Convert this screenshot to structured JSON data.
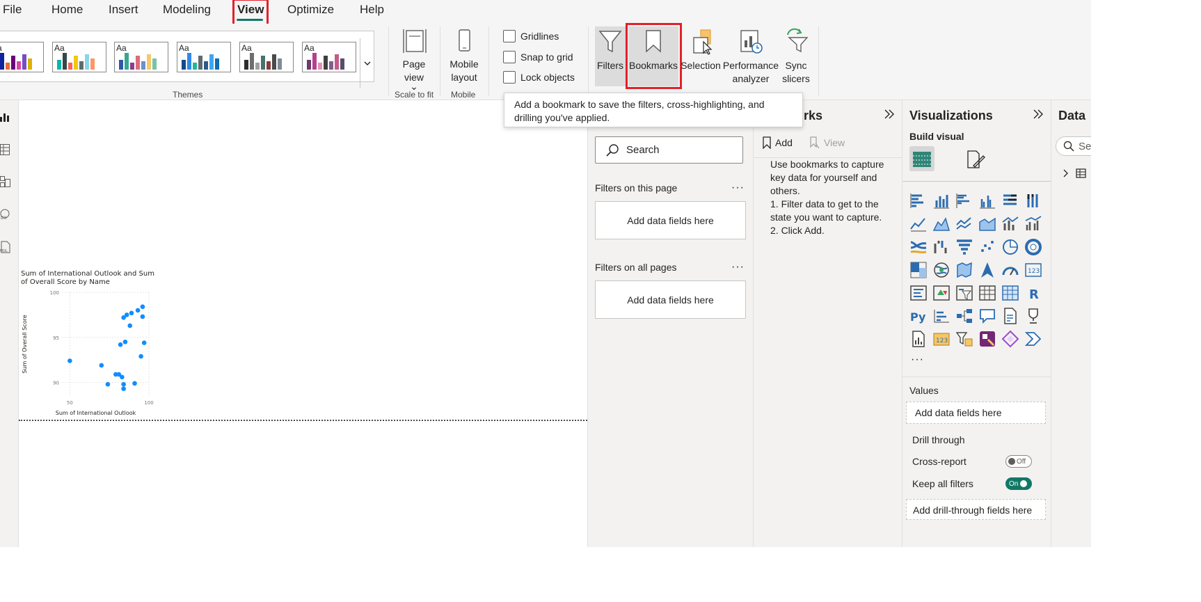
{
  "menu": {
    "items": [
      "File",
      "Home",
      "Insert",
      "Modeling",
      "View",
      "Optimize",
      "Help"
    ],
    "active": "View"
  },
  "ribbon": {
    "themes_label": "Themes",
    "theme_glyph": "Aa",
    "themes": [
      {
        "colors": [
          "#118dff",
          "#12239e",
          "#e66c37",
          "#6b007b",
          "#e044a7",
          "#744ec2",
          "#d9b300"
        ]
      },
      {
        "colors": [
          "#01b8aa",
          "#374649",
          "#fd625e",
          "#f2c80f",
          "#5f6b6d",
          "#8ad4eb",
          "#fe9666"
        ]
      },
      {
        "colors": [
          "#3257a8",
          "#37a794",
          "#8b3d88",
          "#dd6b7f",
          "#6b91c9",
          "#f5c869",
          "#77c4a8"
        ]
      },
      {
        "colors": [
          "#134a89",
          "#2e8ae6",
          "#1fb99f",
          "#5f6b6d",
          "#2a5b8c",
          "#41a5ee",
          "#0f6bb3"
        ]
      },
      {
        "colors": [
          "#2d2d2d",
          "#6e6e6e",
          "#a0a0a0",
          "#49716f",
          "#8d3b3b",
          "#4a4a4a",
          "#7d8b9a"
        ]
      },
      {
        "colors": [
          "#6d3a6d",
          "#b6408e",
          "#e58fb3",
          "#3f3f3f",
          "#7f5f8f",
          "#c45b87",
          "#5a4b6b"
        ]
      }
    ],
    "scale_to_fit": {
      "button": "Page view",
      "chevron": "⌄",
      "group": "Scale to fit"
    },
    "mobile": {
      "button": "Mobile layout",
      "group": "Mobile"
    },
    "checkboxes": [
      {
        "label": "Gridlines",
        "checked": false
      },
      {
        "label": "Snap to grid",
        "checked": false
      },
      {
        "label": "Lock objects",
        "checked": false
      }
    ],
    "pane_buttons": {
      "filters": "Filters",
      "bookmarks": "Bookmarks",
      "selection": "Selection",
      "performance": "Performance analyzer",
      "sync": "Sync slicers"
    }
  },
  "tooltip": {
    "text": "Add a bookmark to save the filters, cross-highlighting, and drilling you've applied."
  },
  "chart_data": {
    "type": "scatter",
    "title": "Sum of International Outlook and Sum of Overall Score by Name",
    "xlabel": "Sum of International Outlook",
    "ylabel": "Sum of Overall Score",
    "xlim": [
      45,
      100
    ],
    "ylim": [
      88.5,
      100
    ],
    "x_ticks": [
      "50",
      "100"
    ],
    "y_ticks": [
      "90",
      "95",
      "100"
    ],
    "color": "#118dff",
    "points": [
      {
        "x": 50,
        "y": 92.4
      },
      {
        "x": 70,
        "y": 91.9
      },
      {
        "x": 74,
        "y": 89.8
      },
      {
        "x": 79,
        "y": 90.9
      },
      {
        "x": 81,
        "y": 90.9
      },
      {
        "x": 82,
        "y": 94.2
      },
      {
        "x": 83,
        "y": 90.6
      },
      {
        "x": 84,
        "y": 89.8
      },
      {
        "x": 84,
        "y": 89.3
      },
      {
        "x": 84,
        "y": 97.2
      },
      {
        "x": 85,
        "y": 94.5
      },
      {
        "x": 86,
        "y": 97.5
      },
      {
        "x": 88,
        "y": 96.3
      },
      {
        "x": 89,
        "y": 97.7
      },
      {
        "x": 91,
        "y": 89.9
      },
      {
        "x": 93,
        "y": 98.0
      },
      {
        "x": 95,
        "y": 92.9
      },
      {
        "x": 96,
        "y": 97.3
      },
      {
        "x": 96,
        "y": 98.4
      },
      {
        "x": 97,
        "y": 94.4
      }
    ]
  },
  "filters_pane": {
    "search_placeholder": "Search",
    "on_this_page": "Filters on this page",
    "on_all_pages": "Filters on all pages",
    "drop_label": "Add data fields here",
    "more": "···"
  },
  "bookmarks_pane": {
    "title": "Bookmarks",
    "visible_title": "rks",
    "add": "Add",
    "view": "View",
    "help_lines": [
      "Use bookmarks to capture",
      "key data for yourself and",
      "others.",
      "1. Filter data to get to the",
      "state you want to capture.",
      "2. Click Add."
    ]
  },
  "viz_pane": {
    "title": "Visualizations",
    "build_visual": "Build visual",
    "more": "···",
    "values_label": "Values",
    "values_drop": "Add data fields here",
    "drill_through": "Drill through",
    "cross_report": {
      "label": "Cross-report",
      "state": "Off"
    },
    "keep_all_filters": {
      "label": "Keep all filters",
      "state": "On"
    },
    "drill_drop": "Add drill-through fields here",
    "accent": "#117865",
    "icon_color": "#2b6cb0"
  },
  "data_pane": {
    "title": "Data",
    "search_placeholder": "Se"
  }
}
